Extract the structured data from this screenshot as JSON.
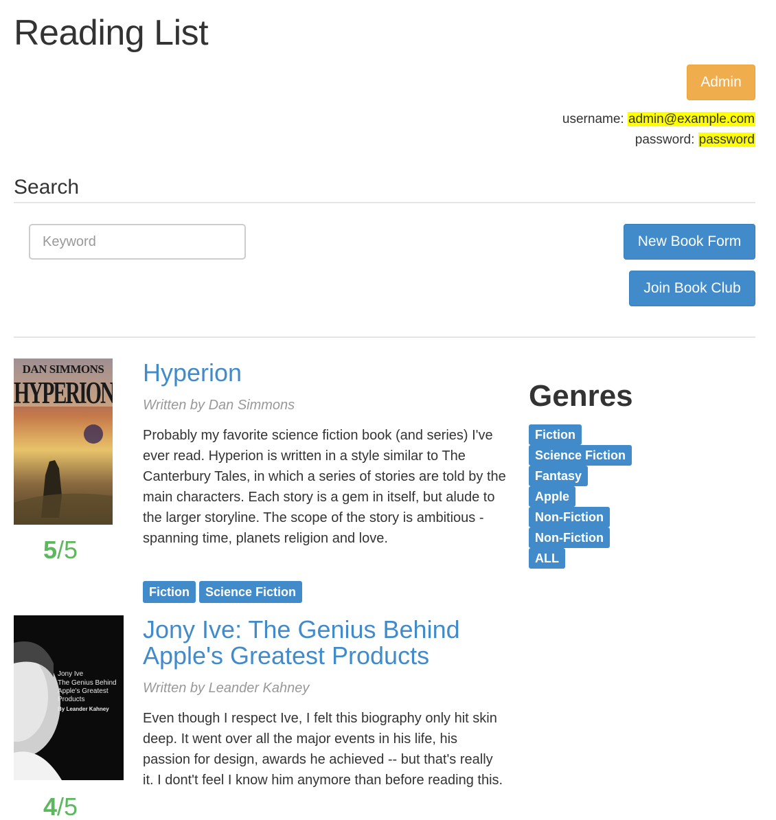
{
  "header": {
    "title": "Reading List"
  },
  "admin": {
    "button_label": "Admin",
    "username_label": "username: ",
    "username_value": "admin@example.com",
    "password_label": "password: ",
    "password_value": "password"
  },
  "search": {
    "title": "Search",
    "keyword_placeholder": "Keyword",
    "new_book_label": "New Book Form",
    "join_club_label": "Join Book Club"
  },
  "books": [
    {
      "title": "Hyperion",
      "author": "Written by Dan Simmons",
      "description": "Probably my favorite science fiction book (and series) I've ever read. Hyperion is written in a style similar to The Canterbury Tales, in which a series of stories are told by the main characters. Each story is a gem in itself, but alude to the larger storyline. The scope of the story is ambitious - spanning time, planets religion and love.",
      "rating_value": "5",
      "rating_max": "/5",
      "tags": [
        "Fiction",
        "Science Fiction"
      ],
      "cover": {
        "top_text": "DAN SIMMONS",
        "main_text": "HYPERION"
      }
    },
    {
      "title": "Jony Ive: The Genius Behind Apple's Greatest Products",
      "author": "Written by Leander Kahney",
      "description": "Even though I respect Ive, I felt this biography only hit skin deep. It went over all the major events in his life, his passion for design, awards he achieved -- but that's really it. I dont't feel I know him anymore than before reading this.",
      "rating_value": "4",
      "rating_max": "/5",
      "cover": {
        "line1": "Jony Ive",
        "line2": "The Genius Behind",
        "line3": "Apple's Greatest",
        "line4": "Products",
        "byline": "By Leander Kahney"
      }
    }
  ],
  "genres": {
    "title": "Genres",
    "items": [
      "Fiction",
      "Science Fiction",
      "Fantasy",
      "Apple",
      "Non-Fiction",
      "Non-Fiction",
      "ALL"
    ]
  },
  "colors": {
    "primary": "#428bca",
    "warning": "#f0ad4e",
    "success": "#5cb85c",
    "highlight": "#ffff00"
  }
}
